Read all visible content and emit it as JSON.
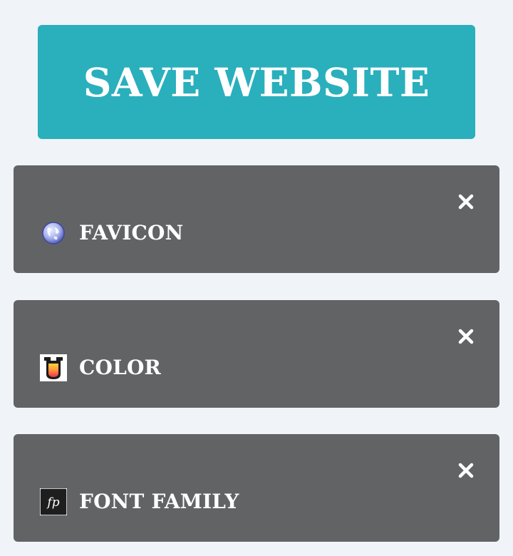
{
  "save_button": {
    "label": "SAVE WEBSITE"
  },
  "colors": {
    "background": "#f0f3f7",
    "save_button": "#2aafbc",
    "card": "#626365",
    "text": "#ffffff"
  },
  "panels": [
    {
      "label": "FAVICON",
      "icon": "globe-icon",
      "close_icon": "close-icon"
    },
    {
      "label": "COLOR",
      "icon": "paint-bucket-icon",
      "close_icon": "close-icon"
    },
    {
      "label": "FONT FAMILY",
      "icon": "font-fp-icon",
      "close_icon": "close-icon"
    }
  ]
}
